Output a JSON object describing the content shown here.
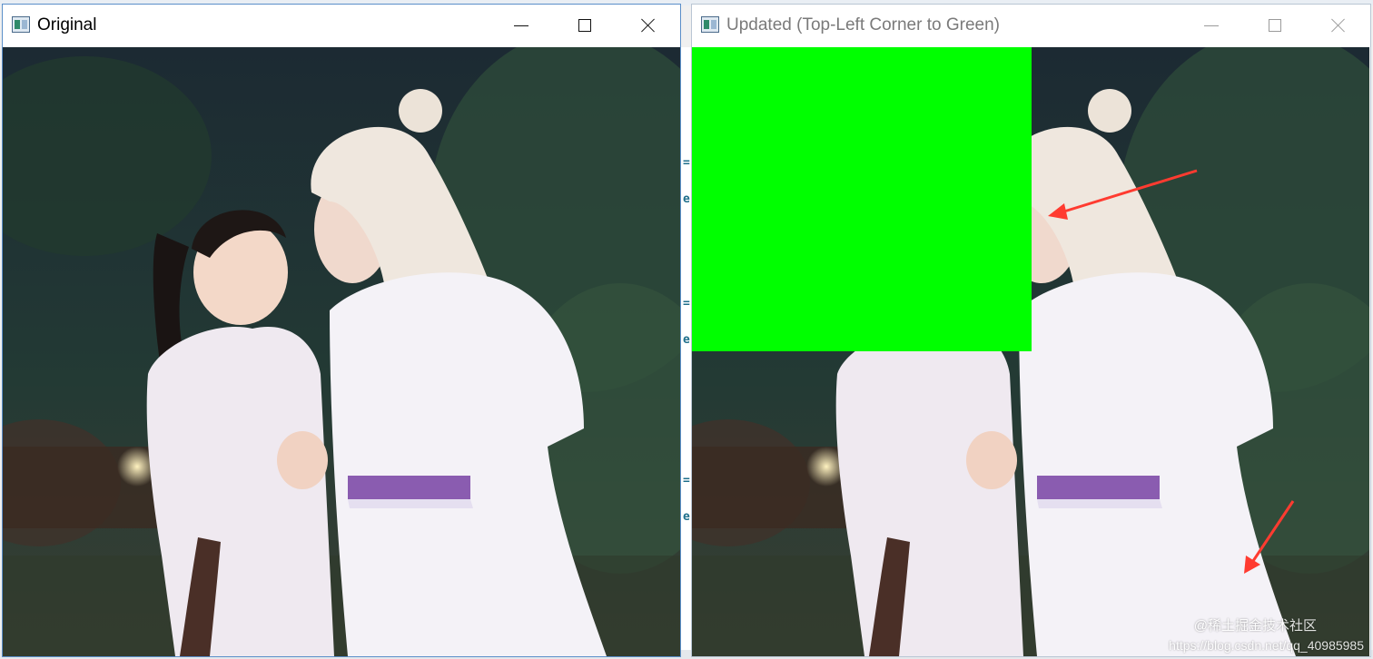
{
  "windows": {
    "original": {
      "title": "Original"
    },
    "updated": {
      "title": "Updated (Top-Left Corner to Green)"
    }
  },
  "controls": {
    "minimize": "minimize-icon",
    "maximize": "maximize-icon",
    "close": "close-icon"
  },
  "colors": {
    "patch": "#00ff00",
    "arrow": "#ff3b30"
  },
  "watermark": {
    "line1": "@稀土掘金技术社区",
    "line2": "https://blog.csdn.net/qq_40985985"
  }
}
